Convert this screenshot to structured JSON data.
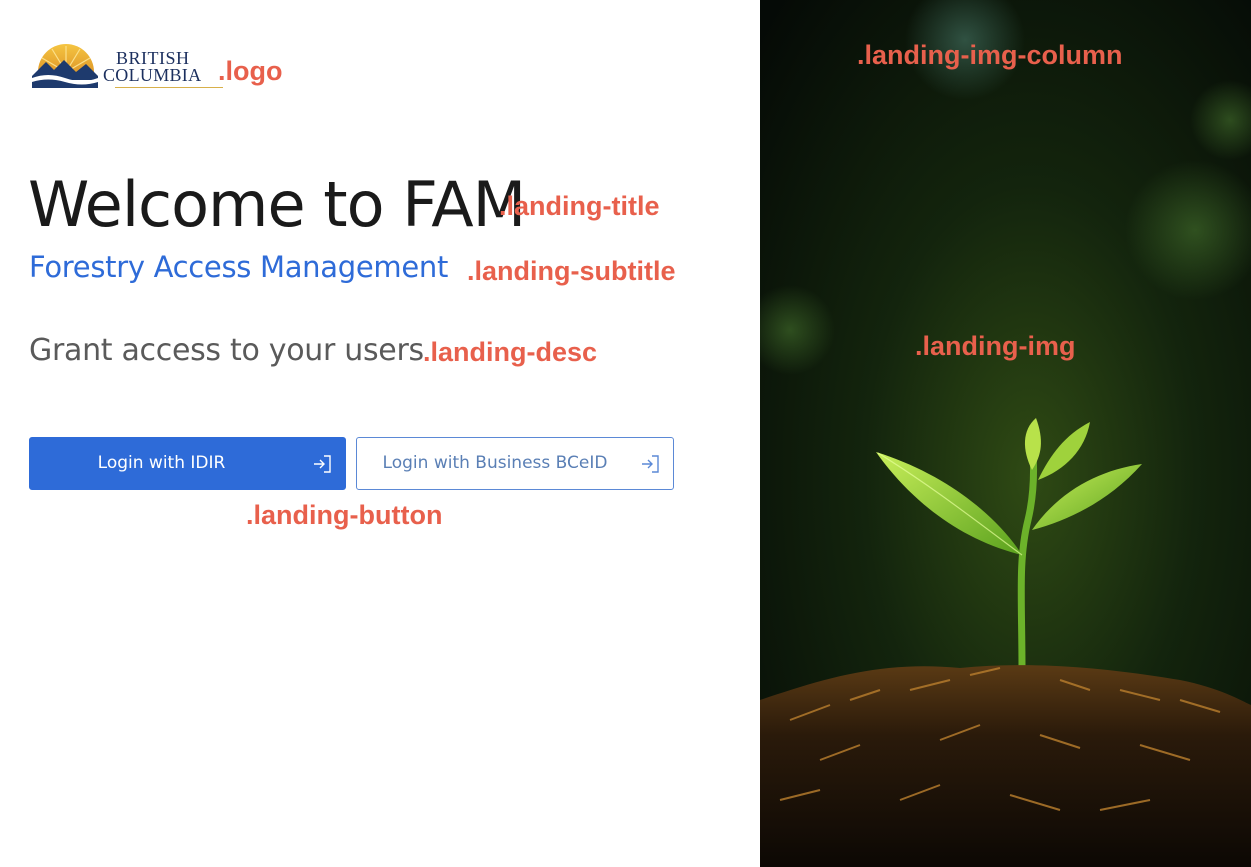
{
  "logo": {
    "line1": "BRITISH",
    "line2": "COLUMBIA",
    "annotation": ".logo"
  },
  "landing": {
    "title": "Welcome to FAM",
    "title_annotation": ".landing-title",
    "subtitle": "Forestry Access Management",
    "subtitle_annotation": ".landing-subtitle",
    "desc": "Grant access to your users",
    "desc_annotation": ".landing-desc",
    "buttons": [
      {
        "label": "Login with IDIR",
        "icon": "login-icon"
      },
      {
        "label": "Login with Business BCeID",
        "icon": "login-icon"
      }
    ],
    "button_annotation": ".landing-button"
  },
  "image_column": {
    "column_annotation": ".landing-img-column",
    "img_annotation": ".landing-img"
  },
  "colors": {
    "primary": "#2e6bd8",
    "annotation": "#e8604c",
    "title": "#1a1a1a"
  }
}
